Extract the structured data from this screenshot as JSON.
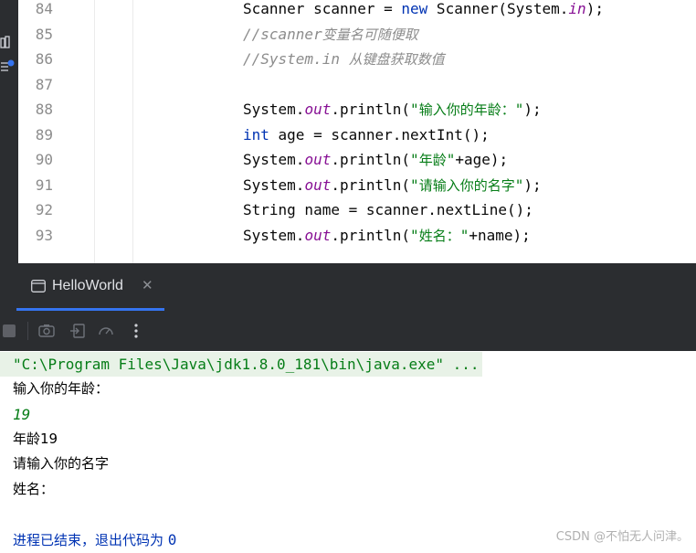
{
  "editor": {
    "lines": [
      {
        "no": "84",
        "parts": [
          {
            "t": "Scanner scanner = ",
            "c": "plain"
          },
          {
            "t": "new",
            "c": "kw"
          },
          {
            "t": " Scanner(System.",
            "c": "plain"
          },
          {
            "t": "in",
            "c": "field"
          },
          {
            "t": ");",
            "c": "plain"
          }
        ]
      },
      {
        "no": "85",
        "parts": [
          {
            "t": "//scanner",
            "c": "comment"
          },
          {
            "t": "变量名可随便取",
            "c": "comment-cjk"
          }
        ]
      },
      {
        "no": "86",
        "parts": [
          {
            "t": "//System.in ",
            "c": "comment"
          },
          {
            "t": "从键盘获取数值",
            "c": "comment-cjk"
          }
        ]
      },
      {
        "no": "87",
        "parts": []
      },
      {
        "no": "88",
        "parts": [
          {
            "t": "System.",
            "c": "plain"
          },
          {
            "t": "out",
            "c": "field"
          },
          {
            "t": ".println(",
            "c": "plain"
          },
          {
            "t": "\"",
            "c": "str"
          },
          {
            "t": "输入你的年龄：",
            "c": "str-cjk"
          },
          {
            "t": "\"",
            "c": "str"
          },
          {
            "t": ");",
            "c": "plain"
          }
        ]
      },
      {
        "no": "89",
        "parts": [
          {
            "t": "int",
            "c": "kw"
          },
          {
            "t": " age = scanner.nextInt();",
            "c": "plain"
          }
        ]
      },
      {
        "no": "90",
        "parts": [
          {
            "t": "System.",
            "c": "plain"
          },
          {
            "t": "out",
            "c": "field"
          },
          {
            "t": ".println(",
            "c": "plain"
          },
          {
            "t": "\"",
            "c": "str"
          },
          {
            "t": "年龄",
            "c": "str-cjk"
          },
          {
            "t": "\"",
            "c": "str"
          },
          {
            "t": "+age);",
            "c": "plain"
          }
        ]
      },
      {
        "no": "91",
        "parts": [
          {
            "t": "System.",
            "c": "plain"
          },
          {
            "t": "out",
            "c": "field"
          },
          {
            "t": ".println(",
            "c": "plain"
          },
          {
            "t": "\"",
            "c": "str"
          },
          {
            "t": "请输入你的名字",
            "c": "str-cjk"
          },
          {
            "t": "\"",
            "c": "str"
          },
          {
            "t": ");",
            "c": "plain"
          }
        ]
      },
      {
        "no": "92",
        "parts": [
          {
            "t": "String name = scanner.nextLine();",
            "c": "plain"
          }
        ]
      },
      {
        "no": "93",
        "parts": [
          {
            "t": "System.",
            "c": "plain"
          },
          {
            "t": "out",
            "c": "field"
          },
          {
            "t": ".println(",
            "c": "plain"
          },
          {
            "t": "\"",
            "c": "str"
          },
          {
            "t": "姓名：",
            "c": "str-cjk"
          },
          {
            "t": "\"",
            "c": "str"
          },
          {
            "t": "+name);",
            "c": "plain"
          }
        ]
      }
    ]
  },
  "run_panel": {
    "tab_label": "HelloWorld",
    "close_glyph": "✕",
    "toolbar_icons": [
      "stop-icon",
      "camera-icon",
      "exit-icon",
      "gauge-icon",
      "more-vertical-icon"
    ]
  },
  "console": {
    "command": "\"C:\\Program Files\\Java\\jdk1.8.0_181\\bin\\java.exe\" ...",
    "output1": "输入你的年龄：",
    "input_age": "19",
    "output2": "年龄19",
    "output3": "请输入你的名字",
    "output4": "姓名：",
    "exit_text": "进程已结束，退出代码为 ",
    "exit_code": "0"
  },
  "watermark": "CSDN @不怕无人问津。",
  "colors": {
    "ide_dark": "#2b2d30",
    "keyword": "#0033b3",
    "field": "#871094",
    "string": "#067d17",
    "comment": "#8c8c8c",
    "tab_accent": "#3574f0"
  }
}
